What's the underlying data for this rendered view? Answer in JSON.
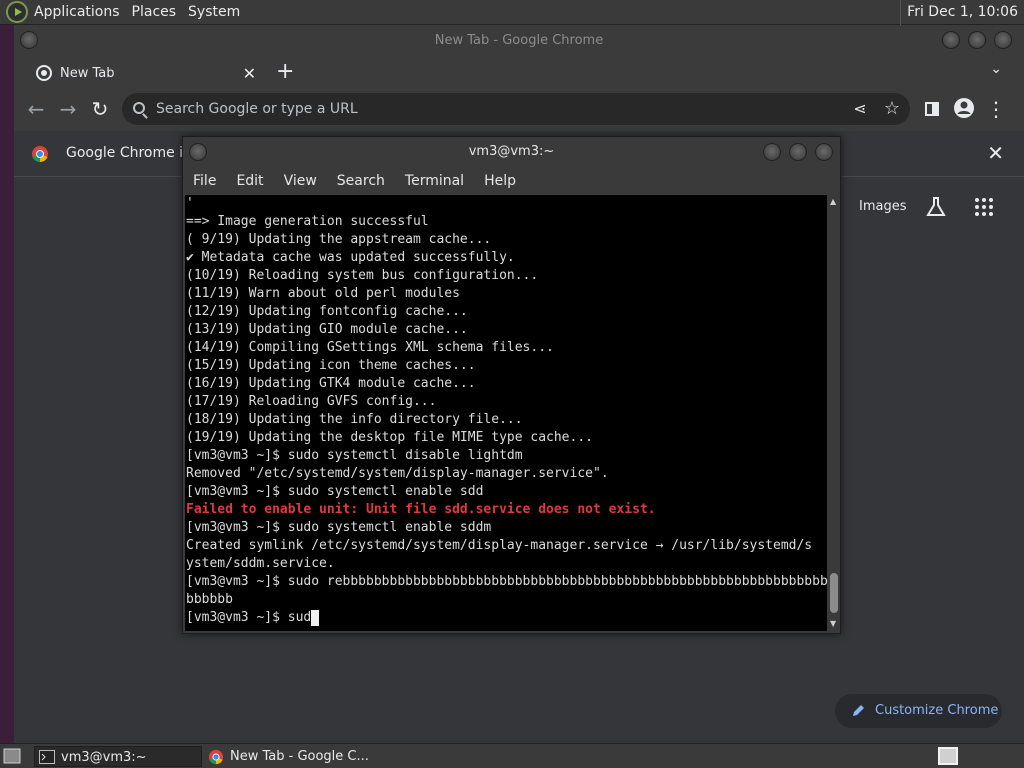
{
  "top_panel": {
    "menus": [
      "Applications",
      "Places",
      "System"
    ],
    "clock": "Fri Dec 1, 10:06"
  },
  "chrome": {
    "window_title": "New Tab - Google Chrome",
    "tab_title": "New Tab",
    "omnibox_placeholder": "Search Google or type a URL",
    "infobar_text": "Google Chrome isn",
    "images_link": "Images",
    "customize_label": "Customize Chrome"
  },
  "terminal": {
    "title": "vm3@vm3:~",
    "menu": [
      "File",
      "Edit",
      "View",
      "Search",
      "Terminal",
      "Help"
    ],
    "lines": [
      {
        "text": "'",
        "style": "normal"
      },
      {
        "text": "==> Image generation successful",
        "style": "normal"
      },
      {
        "text": "( 9/19) Updating the appstream cache...",
        "style": "normal"
      },
      {
        "text": "✔ Metadata cache was updated successfully.",
        "style": "normal"
      },
      {
        "text": "(10/19) Reloading system bus configuration...",
        "style": "normal"
      },
      {
        "text": "(11/19) Warn about old perl modules",
        "style": "normal"
      },
      {
        "text": "(12/19) Updating fontconfig cache...",
        "style": "normal"
      },
      {
        "text": "(13/19) Updating GIO module cache...",
        "style": "normal"
      },
      {
        "text": "(14/19) Compiling GSettings XML schema files...",
        "style": "normal"
      },
      {
        "text": "(15/19) Updating icon theme caches...",
        "style": "normal"
      },
      {
        "text": "(16/19) Updating GTK4 module cache...",
        "style": "normal"
      },
      {
        "text": "(17/19) Reloading GVFS config...",
        "style": "normal"
      },
      {
        "text": "(18/19) Updating the info directory file...",
        "style": "normal"
      },
      {
        "text": "(19/19) Updating the desktop file MIME type cache...",
        "style": "normal"
      },
      {
        "text": "[vm3@vm3 ~]$ sudo systemctl disable lightdm",
        "style": "normal"
      },
      {
        "text": "Removed \"/etc/systemd/system/display-manager.service\".",
        "style": "normal"
      },
      {
        "text": "[vm3@vm3 ~]$ sudo systemctl enable sdd",
        "style": "normal"
      },
      {
        "text": "Failed to enable unit: Unit file sdd.service does not exist.",
        "style": "err"
      },
      {
        "text": "[vm3@vm3 ~]$ sudo systemctl enable sddm",
        "style": "normal"
      },
      {
        "text": "Created symlink /etc/systemd/system/display-manager.service → /usr/lib/systemd/s",
        "style": "normal"
      },
      {
        "text": "ystem/sddm.service.",
        "style": "normal"
      },
      {
        "text": "[vm3@vm3 ~]$ sudo rebbbbbbbbbbbbbbbbbbbbbbbbbbbbbbbbbbbbbbbbbbbbbbbbbbbbbbbbbbbbbb^C",
        "style": "normal"
      },
      {
        "text": "bbbbbb",
        "style": "normal"
      }
    ],
    "prompt_line": "[vm3@vm3 ~]$ sud"
  },
  "taskbar": {
    "tasks": [
      "vm3@vm3:~",
      "New Tab - Google C..."
    ]
  }
}
